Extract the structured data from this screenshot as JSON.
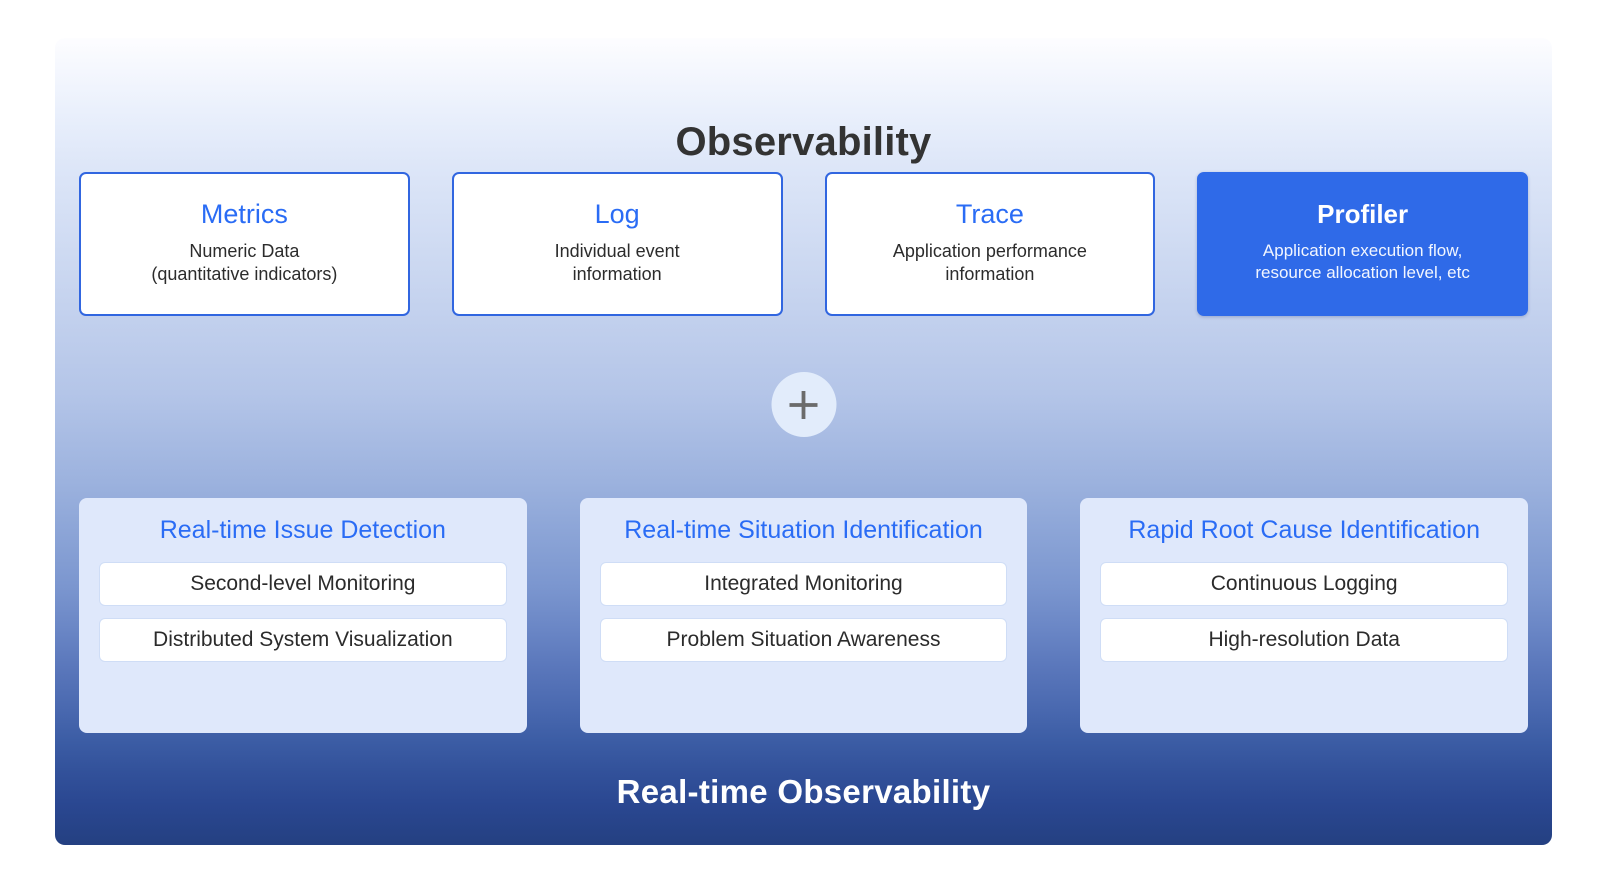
{
  "diagram": {
    "title": "Observability",
    "footer": "Real-time Observability",
    "connector_symbol": "+",
    "colors": {
      "accent_blue": "#2a6cf5",
      "card_border": "#3166e0",
      "highlight_fill": "#2f6ae8",
      "panel_fill": "#dfe8fb",
      "footer_band": "#244081",
      "title_text": "#333333"
    }
  },
  "pillars": [
    {
      "title": "Metrics",
      "description": "Numeric Data\n(quantitative indicators)",
      "highlighted": false
    },
    {
      "title": "Log",
      "description": "Individual event\ninformation",
      "highlighted": false
    },
    {
      "title": "Trace",
      "description": "Application performance\ninformation",
      "highlighted": false
    },
    {
      "title": "Profiler",
      "description": "Application execution flow,\nresource allocation level, etc",
      "highlighted": true
    }
  ],
  "benefits": [
    {
      "title": "Real-time Issue Detection",
      "items": [
        "Second-level Monitoring",
        "Distributed System Visualization"
      ]
    },
    {
      "title": "Real-time Situation Identification",
      "items": [
        "Integrated Monitoring",
        "Problem Situation Awareness"
      ]
    },
    {
      "title": "Rapid Root Cause Identification",
      "items": [
        "Continuous Logging",
        "High-resolution Data"
      ]
    }
  ]
}
